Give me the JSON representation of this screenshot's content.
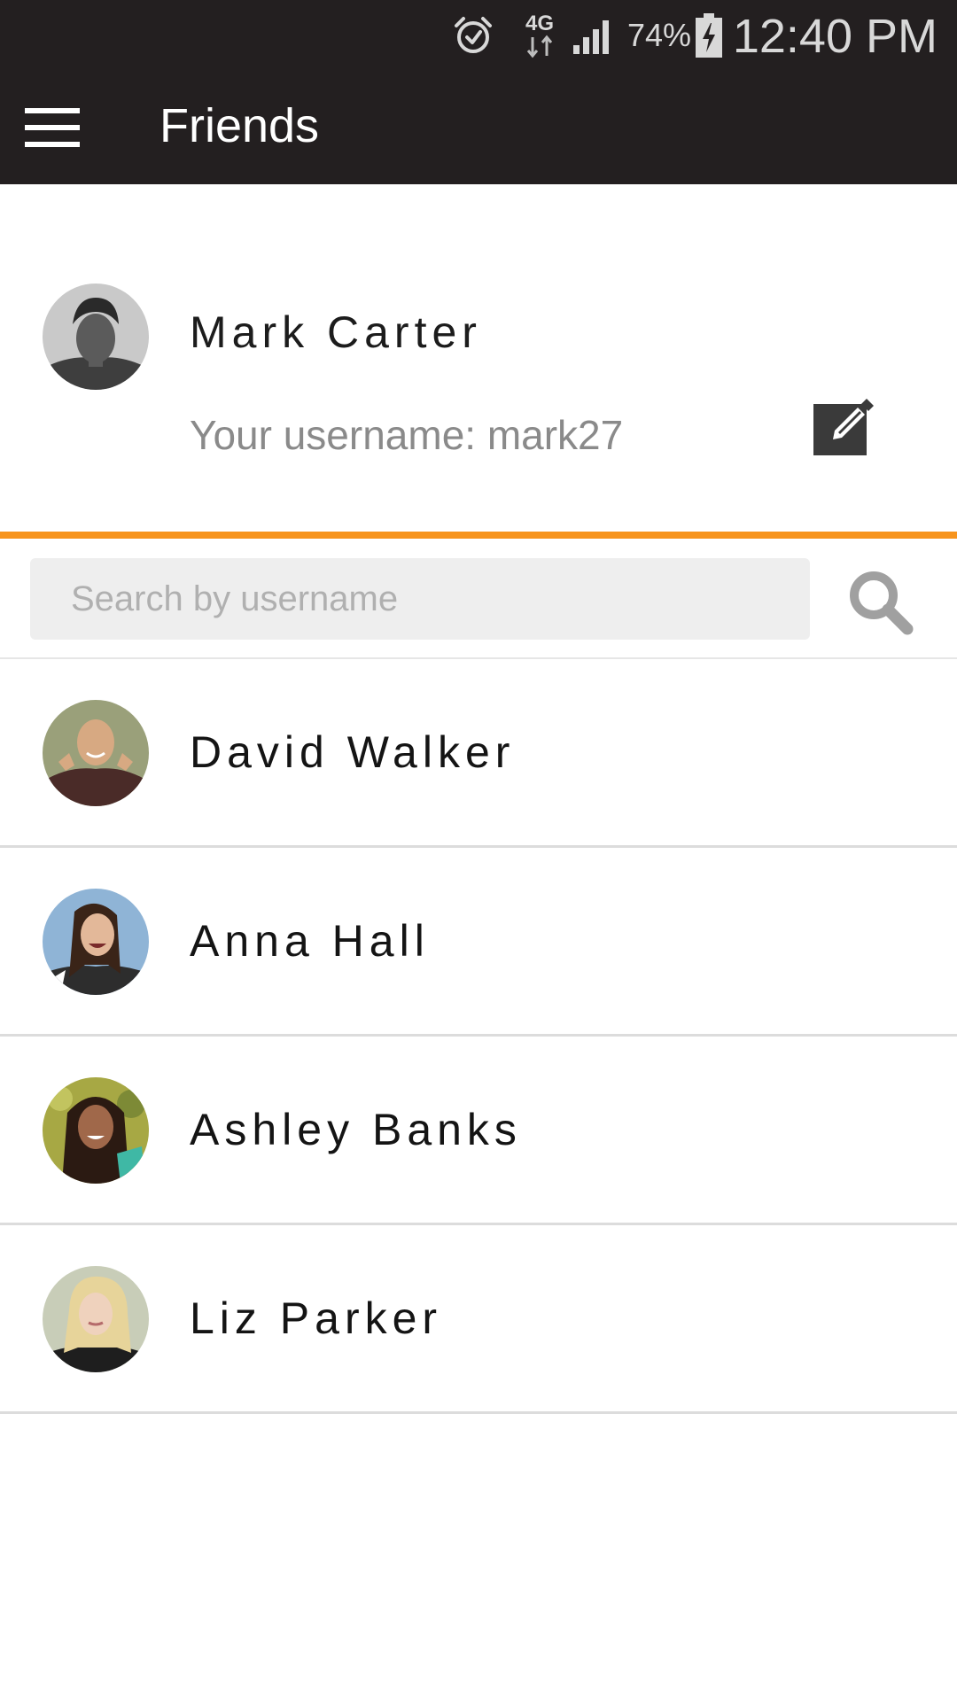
{
  "status_bar": {
    "network": "4G",
    "battery_percent": "74%",
    "time": "12:40 PM",
    "icons": [
      "alarm-icon",
      "network-4g-icon",
      "signal-icon",
      "battery-charging-icon"
    ]
  },
  "app_bar": {
    "title": "Friends",
    "menu_icon": "hamburger-menu-icon"
  },
  "profile": {
    "name": "Mark Carter",
    "username_text": "Your username: mark27",
    "edit_icon": "edit-icon"
  },
  "search": {
    "placeholder": "Search by username",
    "value": "",
    "icon": "search-icon"
  },
  "friends": [
    {
      "name": "David Walker"
    },
    {
      "name": "Anna Hall"
    },
    {
      "name": "Ashley Banks"
    },
    {
      "name": "Liz Parker"
    }
  ],
  "colors": {
    "bar_background": "#231f20",
    "accent": "#f7941d",
    "search_background": "#eeeeee",
    "divider": "#dcdcdc"
  }
}
